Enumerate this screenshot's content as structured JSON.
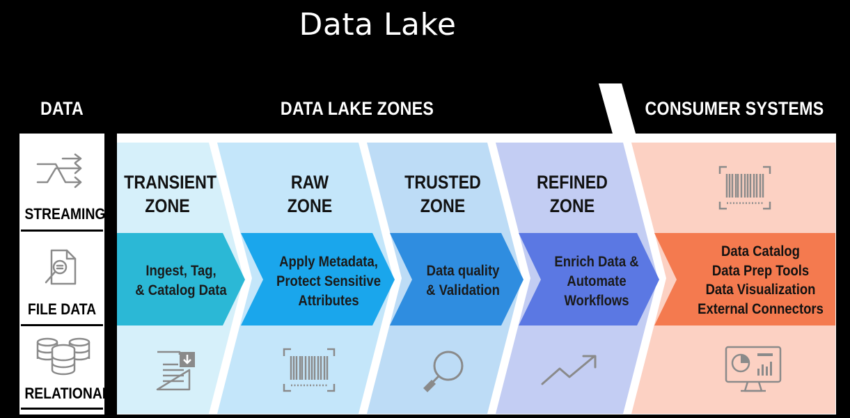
{
  "title": "Data Lake",
  "headers": {
    "data": "DATA",
    "zones": "DATA LAKE ZONES",
    "consumer": "CONSUMER SYSTEMS"
  },
  "sources": [
    {
      "label": "STREAMING",
      "icon": "streaming-arrows-icon"
    },
    {
      "label": "FILE DATA",
      "icon": "document-search-icon"
    },
    {
      "label": "RELATIONAL",
      "icon": "database-icon"
    }
  ],
  "zones": [
    {
      "title_line1": "TRANSIENT",
      "title_line2": "ZONE",
      "desc": [
        "Ingest, Tag,",
        "& Catalog Data"
      ],
      "icon": "document-download-icon"
    },
    {
      "title_line1": "RAW",
      "title_line2": "ZONE",
      "desc": [
        "Apply Metadata,",
        "Protect Sensitive",
        "Attributes"
      ],
      "icon": "barcode-icon"
    },
    {
      "title_line1": "TRUSTED",
      "title_line2": "ZONE",
      "desc": [
        "Data quality",
        "& Validation"
      ],
      "icon": "magnifier-icon"
    },
    {
      "title_line1": "REFINED",
      "title_line2": "ZONE",
      "desc": [
        "Enrich Data &",
        "Automate",
        "Workflows"
      ],
      "icon": "trend-up-icon"
    }
  ],
  "consumer": {
    "items": [
      "Data Catalog",
      "Data Prep Tools",
      "Data Visualization",
      "External Connectors"
    ],
    "top_icon": "barcode-icon",
    "bottom_icon": "monitor-chart-icon"
  },
  "colors": {
    "transient_light": "#d6f0fa",
    "transient_band": "#2bb8d6",
    "raw_light": "#c4e6fa",
    "raw_band": "#1aa6ec",
    "trusted_light": "#bddcf6",
    "trusted_band": "#2f8de0",
    "refined_light": "#c3cdf3",
    "refined_band": "#5b78e3",
    "consumer_light": "#fcd1c3",
    "consumer_band": "#f47a4f"
  }
}
